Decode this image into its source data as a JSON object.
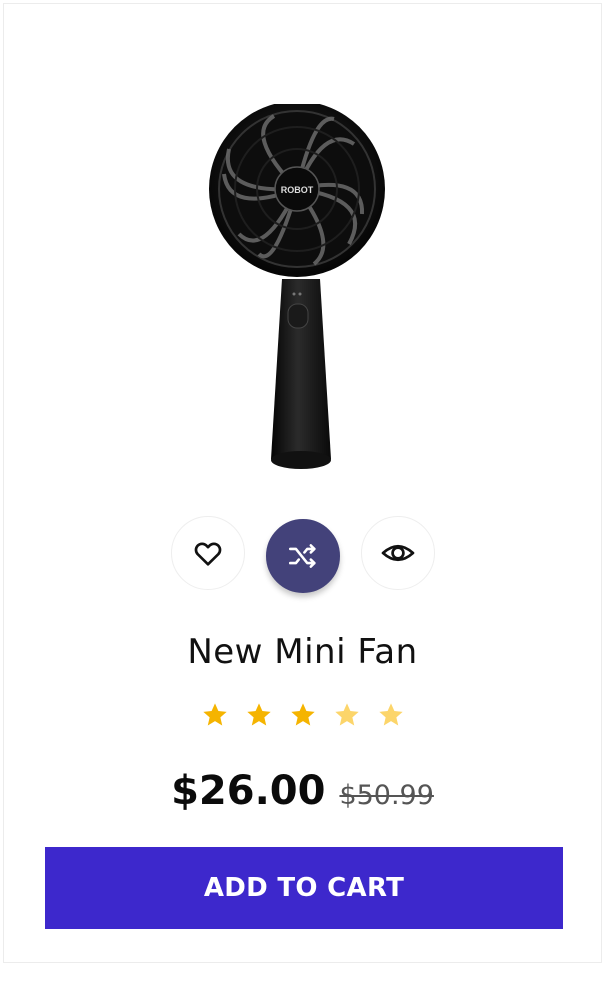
{
  "product": {
    "title": "New Mini Fan",
    "price": "$26.00",
    "old_price": "$50.99",
    "rating_stars": 5,
    "image_icon": "handheld-fan-image"
  },
  "actions": {
    "wishlist_icon": "heart-icon",
    "compare_icon": "shuffle-icon",
    "quickview_icon": "eye-icon"
  },
  "cart": {
    "label": "ADD TO CART"
  },
  "colors": {
    "accent": "#3d28cc",
    "compare_active": "#43427a",
    "star": "#f5b400"
  }
}
